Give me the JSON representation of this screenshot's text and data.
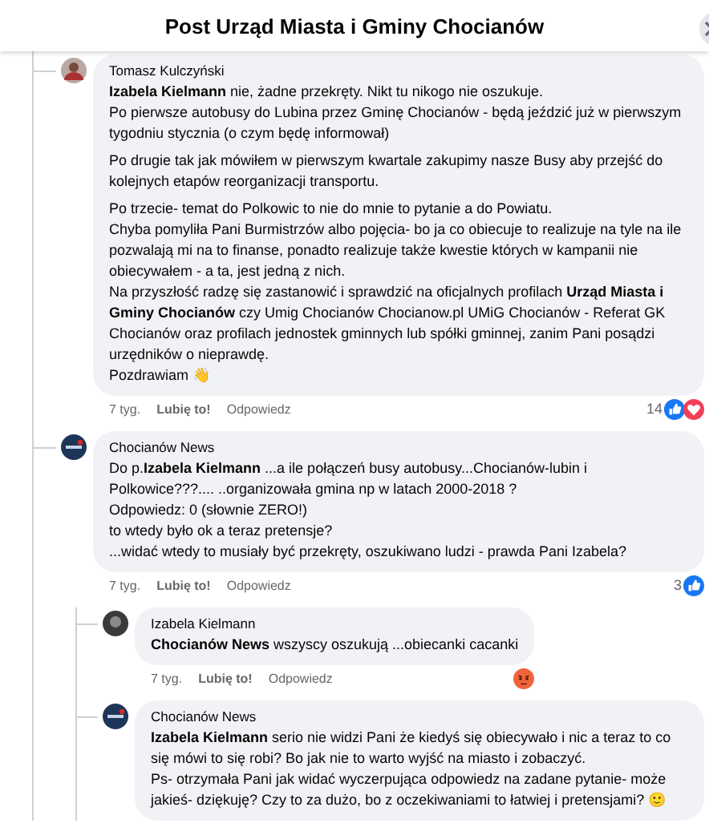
{
  "header": {
    "title": "Post Urząd Miasta i Gminy Chocianów"
  },
  "comments": [
    {
      "author": "Tomasz Kulczyński",
      "avatar": {
        "kind": "photo"
      },
      "paragraphs": [
        "**Izabela Kielmann** nie, żadne przekręty. Nikt tu nikogo nie oszukuje.\nPo pierwsze autobusy do Lubina przez Gminę Chocianów - będą jeździć już w pierwszym tygodniu stycznia (o czym będę informował)",
        "Po drugie tak jak mówiłem w pierwszym kwartale zakupimy nasze Busy aby przejść do kolejnych etapów reorganizacji transportu.",
        "Po trzecie- temat do Polkowic to nie do mnie to pytanie a do Powiatu.\nChyba pomyliła Pani Burmistrzów albo pojęcia- bo ja co obiecuje to realizuje na tyle na ile pozwalają mi na to finanse, ponadto realizuje także kwestie których w kampanii nie obiecywałem - a ta, jest jedną z nich.\nNa przyszłość radzę się zastanowić i sprawdzić na oficjalnych profilach **Urząd Miasta i Gminy Chocianów** czy Umig Chocianów Chocianow.pl UMiG Chocianów - Referat GK Chocianów oraz profilach jednostek gminnych lub spółki gminnej, zanim Pani posądzi urzędników o nieprawdę.\nPozdrawiam 👋"
      ],
      "time": "7 tyg.",
      "like": "Lubię to!",
      "reply": "Odpowiedz",
      "reaction_count": "14",
      "reactions": [
        {
          "kind": "like"
        },
        {
          "kind": "love"
        }
      ]
    },
    {
      "author": "Chocianów News",
      "avatar": {
        "kind": "logo"
      },
      "paragraphs": [
        "Do p.**Izabela Kielmann** ...a ile połączeń busy autobusy...Chocianów-lubin i Polkowice???.... ..organizowała gmina np w latach 2000-2018 ?\nOdpowiedz: 0 (słownie ZERO!)\nto wtedy było ok a teraz pretensje?\n...widać wtedy to musiały być przekręty, oszukiwano ludzi - prawda Pani Izabela?"
      ],
      "time": "7 tyg.",
      "like": "Lubię to!",
      "reply": "Odpowiedz",
      "reaction_count": "3",
      "reactions": [
        {
          "kind": "like"
        }
      ],
      "children": [
        {
          "author": "Izabela Kielmann",
          "avatar": {
            "kind": "dark"
          },
          "paragraphs": [
            "**Chocianów News** wszyscy oszukują ...obiecanki cacanki"
          ],
          "time": "7 tyg.",
          "like": "Lubię to!",
          "reply": "Odpowiedz",
          "reactions": [
            {
              "kind": "angry"
            }
          ]
        },
        {
          "author": "Chocianów News",
          "avatar": {
            "kind": "logo"
          },
          "paragraphs": [
            "**Izabela Kielmann** serio nie widzi Pani że kiedyś się obiecywało i nic a teraz to co się mówi to się robi? Bo jak nie to warto wyjść na miasto i zobaczyć.\nPs- otrzymała Pani jak widać wyczerpująca odpowiedz na zadane pytanie- może jakieś- dziękuję? Czy to za dużo, bo z oczekiwaniami to łatwiej i pretensjami? 🙂"
          ]
        }
      ]
    }
  ]
}
